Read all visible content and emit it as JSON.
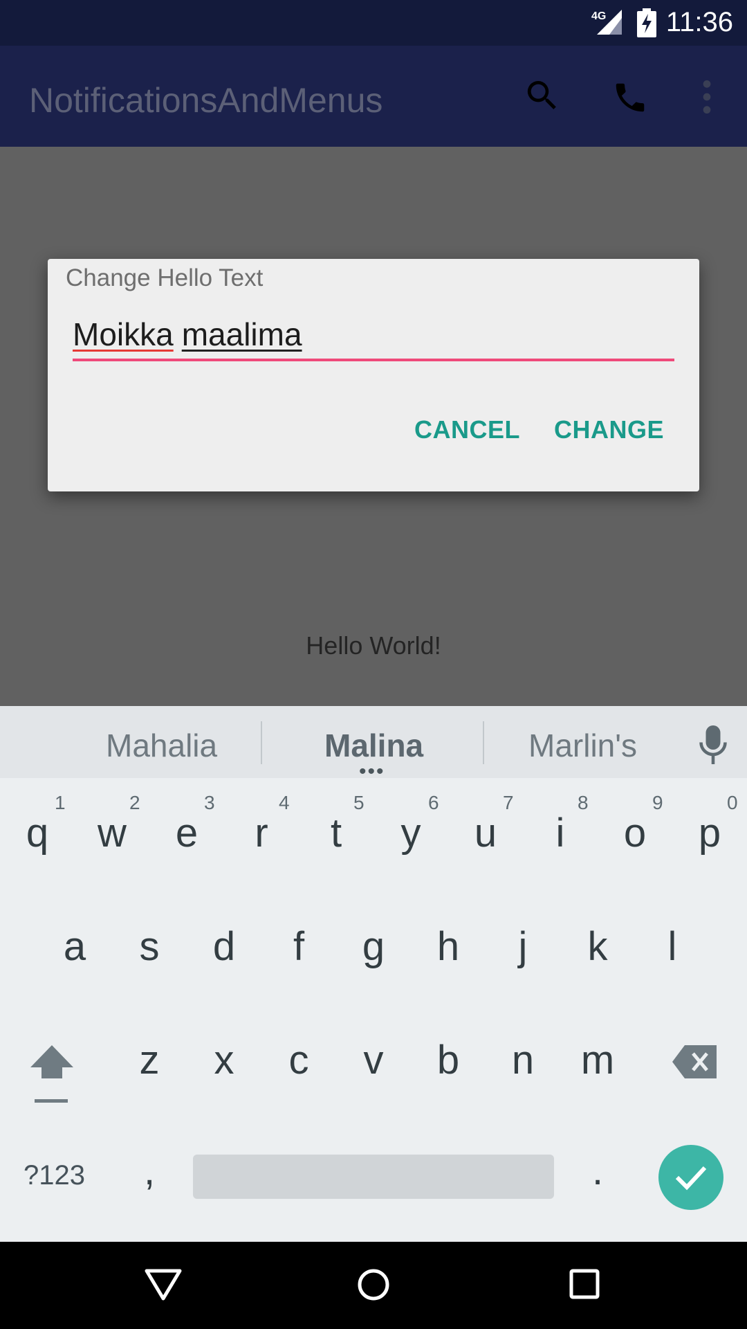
{
  "status_bar": {
    "time": "11:36",
    "network": "4G",
    "icons": [
      "4g-signal-icon",
      "battery-charging-icon"
    ]
  },
  "app_bar": {
    "title": "NotificationsAndMenus",
    "icons": [
      "search-icon",
      "phone-icon",
      "more-vert-icon"
    ]
  },
  "content": {
    "hello_text": "Hello World!"
  },
  "dialog": {
    "title": "Change Hello Text",
    "input": {
      "word1": "Moikka",
      "word2": "maalima"
    },
    "cancel_label": "CANCEL",
    "change_label": "CHANGE"
  },
  "keyboard": {
    "suggestions": [
      "Mahalia",
      "Malina",
      "Marlin's"
    ],
    "row1": [
      "q",
      "w",
      "e",
      "r",
      "t",
      "y",
      "u",
      "i",
      "o",
      "p"
    ],
    "row1_hints": [
      "1",
      "2",
      "3",
      "4",
      "5",
      "6",
      "7",
      "8",
      "9",
      "0"
    ],
    "row2": [
      "a",
      "s",
      "d",
      "f",
      "g",
      "h",
      "j",
      "k",
      "l"
    ],
    "row3": [
      "z",
      "x",
      "c",
      "v",
      "b",
      "n",
      "m"
    ],
    "symbols_label": "?123",
    "comma": ",",
    "period": "."
  },
  "colors": {
    "accent": "#1a9a8a",
    "field_underline": "#ef4a7a",
    "app_bar": "#1b214b",
    "enter_key": "#3db6a6"
  }
}
